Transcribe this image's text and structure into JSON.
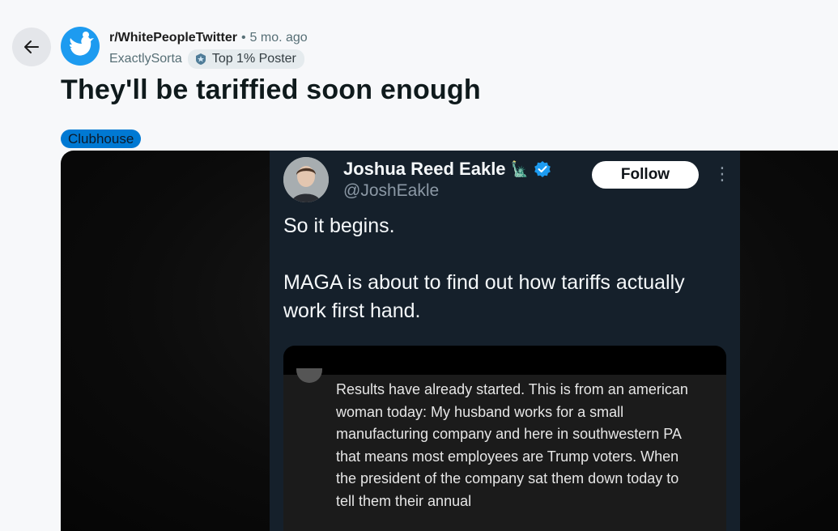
{
  "post": {
    "subreddit": "r/WhitePeopleTwitter",
    "separator": "•",
    "time": "5 mo. ago",
    "author": "ExactlySorta",
    "badge": "Top 1% Poster",
    "title": "They'll be tariffied soon enough",
    "flair": "Clubhouse"
  },
  "tweet": {
    "name": "Joshua Reed Eakle",
    "name_emoji": "🗽",
    "handle": "@JoshEakle",
    "follow_label": "Follow",
    "more_label": "⋮",
    "paragraph1": "So it begins.",
    "paragraph2": "MAGA is about to find out how tariffs actually work first hand."
  },
  "quote": {
    "text": "Results have already started.  This is from an american woman today: My husband works for a small manufacturing company and here in southwestern PA that means most employees are Trump voters. When the president of the company sat them down today to tell them their annual"
  },
  "colors": {
    "page_bg": "#f7f8fa",
    "flair_bg": "#0079d3",
    "tweet_bg": "#15202b",
    "verified": "#1d9bf0"
  },
  "icons": [
    "back-arrow-icon",
    "subreddit-twitter-icon",
    "top-poster-icon",
    "verified-icon",
    "more-options-icon"
  ]
}
